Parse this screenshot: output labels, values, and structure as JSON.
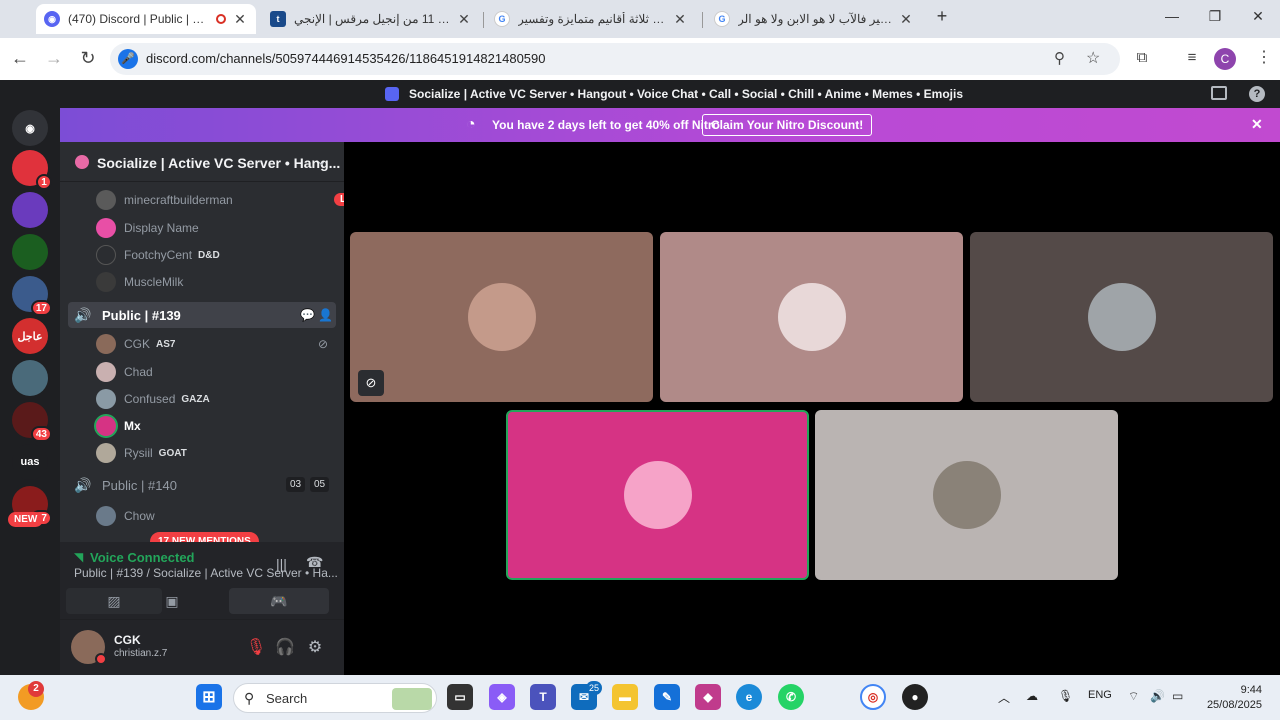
{
  "browser": {
    "tabs": [
      {
        "title": "(470) Discord | Public | #139",
        "favicon": "discord-icon",
        "active": true
      },
      {
        "title": "إصحاح 11 من إنجيل مرقس | الإنجي",
        "favicon": "t-icon",
        "active": false
      },
      {
        "title": "ما هي ثلاثة أقانيم متمايزة وتفسير",
        "favicon": "google-icon",
        "active": false
      },
      {
        "title": "تفسير فالآب لا هو الابن ولا هو الر",
        "favicon": "google-icon",
        "active": false
      }
    ],
    "new_tab": "+",
    "url": "discord.com/channels/505974446914535426/1186451914821480590",
    "profile_initial": "C"
  },
  "discord": {
    "window_title": "Socialize | Active VC Server • Hangout • Voice Chat • Call • Social • Chill • Anime • Memes • Emojis",
    "nitro": {
      "text": "You have 2 days left to get 40% off Nitro",
      "button": "Claim Your Nitro Discount!"
    },
    "servers": [
      {
        "label": "",
        "badge": "1",
        "color": "#e0323c"
      },
      {
        "label": "",
        "badge": "",
        "color": "#6a3bbd"
      },
      {
        "label": "",
        "badge": "",
        "color": "#1b5e20"
      },
      {
        "label": "",
        "badge": "17",
        "color": "#3b5b8c"
      },
      {
        "label": "عاجل",
        "badge": "",
        "color": "#d32f2f"
      },
      {
        "label": "",
        "badge": "",
        "color": "#4a6a7a"
      },
      {
        "label": "",
        "badge": "43",
        "color": "#5a1a1a"
      },
      {
        "label": "uas",
        "badge": "",
        "color": "#1e1f22"
      },
      {
        "label": "",
        "badge": "67",
        "color": "#8a1c1c"
      }
    ],
    "new_label": "NEW",
    "guild_name": "Socialize | Active VC Server • Hang...",
    "members_top": [
      {
        "name": "minecraftbuilderman",
        "tag": "",
        "live": "LIVE",
        "color": "#5a5a5a"
      },
      {
        "name": "Display Name",
        "tag": "",
        "live": "",
        "color": "#e84fa6"
      },
      {
        "name": "FootchyCent",
        "tag": "D&D",
        "live": "",
        "color": "#2b2d31"
      },
      {
        "name": "MuscleMilk",
        "tag": "",
        "live": "",
        "color": "#3a3a3a"
      }
    ],
    "channel_139": "Public | #139",
    "members_139": [
      {
        "name": "CGK",
        "tag": "AS7",
        "color": "#8a6a5a"
      },
      {
        "name": "Chad",
        "tag": "",
        "color": "#c9b0b0"
      },
      {
        "name": "Confused",
        "tag": "GAZA",
        "color": "#8a9aa5"
      },
      {
        "name": "Mx",
        "tag": "",
        "color": "#d63384"
      },
      {
        "name": "Rysiil",
        "tag": "GOAT",
        "color": "#b0a89a"
      }
    ],
    "channel_140": "Public | #140",
    "channel_140_counts": [
      "03",
      "05"
    ],
    "member_140": "Chow",
    "new_mentions": "17 NEW MENTIONS",
    "voice": {
      "status": "Voice Connected",
      "channel": "Public | #139 / Socialize | Active VC Server • Ha..."
    },
    "user": {
      "name": "CGK",
      "tag": "christian.z.7"
    },
    "tiles": [
      {
        "bg": "#8e6a5e",
        "pic": "#c49a8a",
        "muted": true
      },
      {
        "bg": "#b08a88",
        "pic": "#e8d8d8",
        "muted": false
      },
      {
        "bg": "#544a48",
        "pic": "#9fa4a8",
        "muted": false
      },
      {
        "bg": "#d63384",
        "pic": "#f6a3c8",
        "muted": false
      },
      {
        "bg": "#bab4b2",
        "pic": "#8a8278",
        "muted": false
      }
    ]
  },
  "taskbar": {
    "search": "Search",
    "notif_badge": "2",
    "mail_badge": "25",
    "lang": "ENG",
    "time": "9:44",
    "date": "25/08/2025"
  }
}
